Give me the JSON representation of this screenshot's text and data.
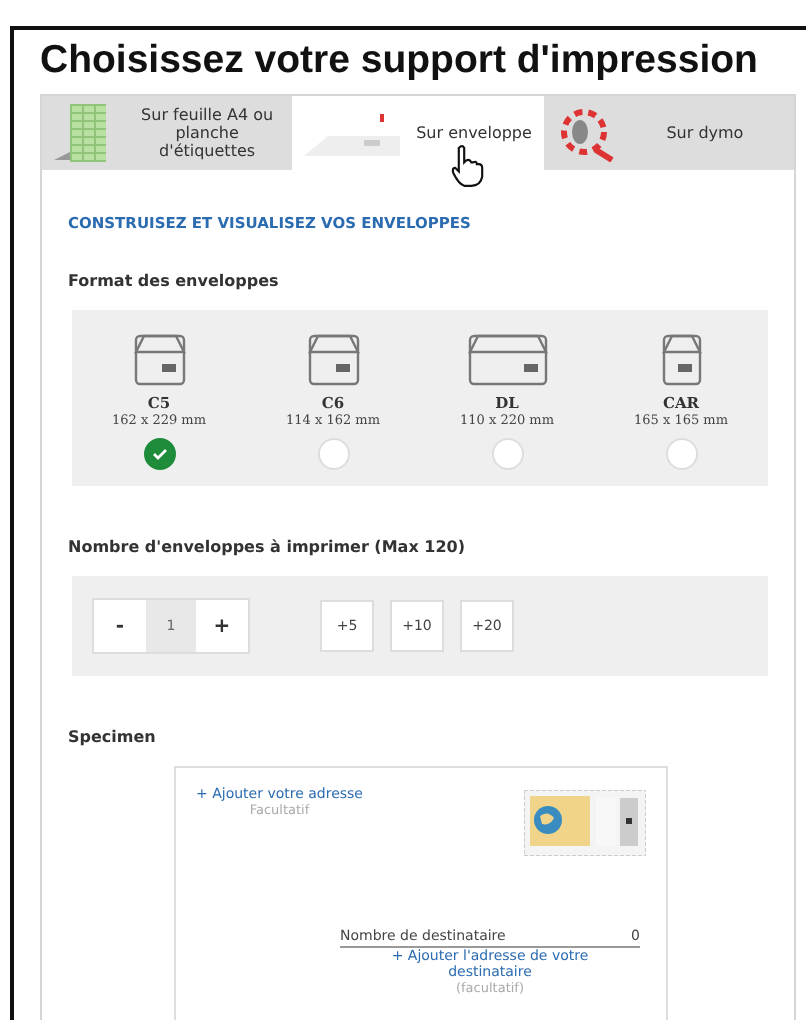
{
  "title": "Choisissez votre support d'impression",
  "tabs": [
    {
      "label": "Sur feuille A4 ou planche d'étiquettes",
      "kind": "sheet",
      "selected": false
    },
    {
      "label": "Sur enveloppe",
      "kind": "envelope",
      "selected": true
    },
    {
      "label": "Sur dymo",
      "kind": "dymo",
      "selected": false
    }
  ],
  "heading": "CONSTRUISEZ ET VISUALISEZ VOS ENVELOPPES",
  "format_section": {
    "label": "Format des enveloppes",
    "formats": [
      {
        "name": "C5",
        "size": "162 x 229 mm",
        "kind": "portrait",
        "selected": true
      },
      {
        "name": "C6",
        "size": "114 x 162 mm",
        "kind": "portrait",
        "selected": false
      },
      {
        "name": "DL",
        "size": "110 x 220 mm",
        "kind": "wide",
        "selected": false
      },
      {
        "name": "CAR",
        "size": "165 x 165 mm",
        "kind": "square",
        "selected": false
      }
    ]
  },
  "quantity_section": {
    "label": "Nombre d'enveloppes à imprimer (Max 120)",
    "minus": "-",
    "value": "1",
    "plus": "+",
    "increments": [
      "+5",
      "+10",
      "+20"
    ]
  },
  "specimen": {
    "label": "Specimen",
    "sender_link": "+ Ajouter votre adresse",
    "sender_hint": "Facultatif",
    "recipient_count_label": "Nombre de destinataire",
    "recipient_count": "0",
    "recipient_link": "+ Ajouter l'adresse de votre destinataire",
    "recipient_hint": "(facultatif)"
  }
}
